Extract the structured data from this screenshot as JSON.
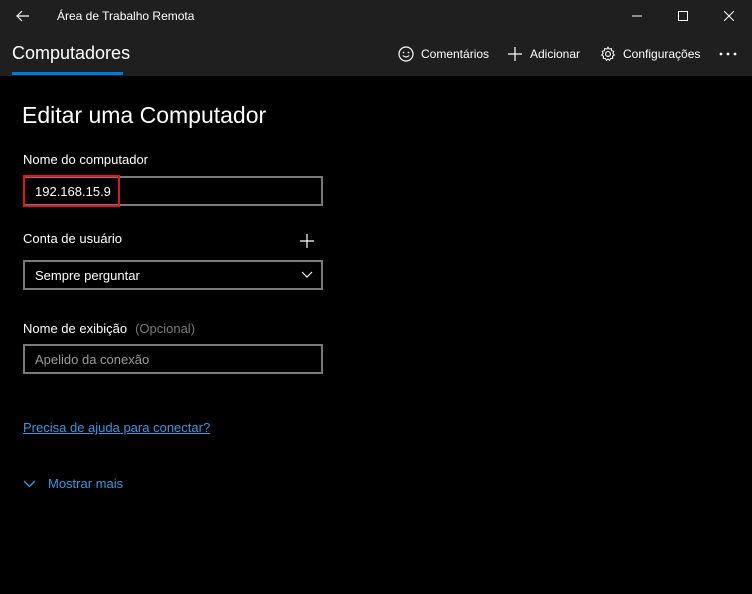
{
  "window": {
    "title": "Área de Trabalho Remota",
    "controls": [
      "minimize-icon",
      "maximize-icon",
      "close-icon"
    ]
  },
  "commandbar": {
    "tab": "Computadores",
    "items": [
      {
        "label": "Comentários",
        "icon": "smiley-icon"
      },
      {
        "label": "Adicionar",
        "icon": "plus-icon"
      },
      {
        "label": "Configurações",
        "icon": "gear-icon"
      }
    ],
    "more_icon": "ellipsis-icon"
  },
  "form": {
    "heading": "Editar uma Computador",
    "computer_name": {
      "label": "Nome do computador",
      "value": "192.168.15.9"
    },
    "user_account": {
      "label": "Conta de usuário",
      "selected": "Sempre perguntar"
    },
    "display_name": {
      "label": "Nome de exibição",
      "optional": "(Opcional)",
      "placeholder": "Apelido da conexão"
    },
    "help_link": "Precisa de ajuda para conectar?",
    "show_more": "Mostrar mais"
  },
  "colors": {
    "accent": "#0078d7",
    "link": "#3a96dd",
    "highlight": "#e81123"
  }
}
